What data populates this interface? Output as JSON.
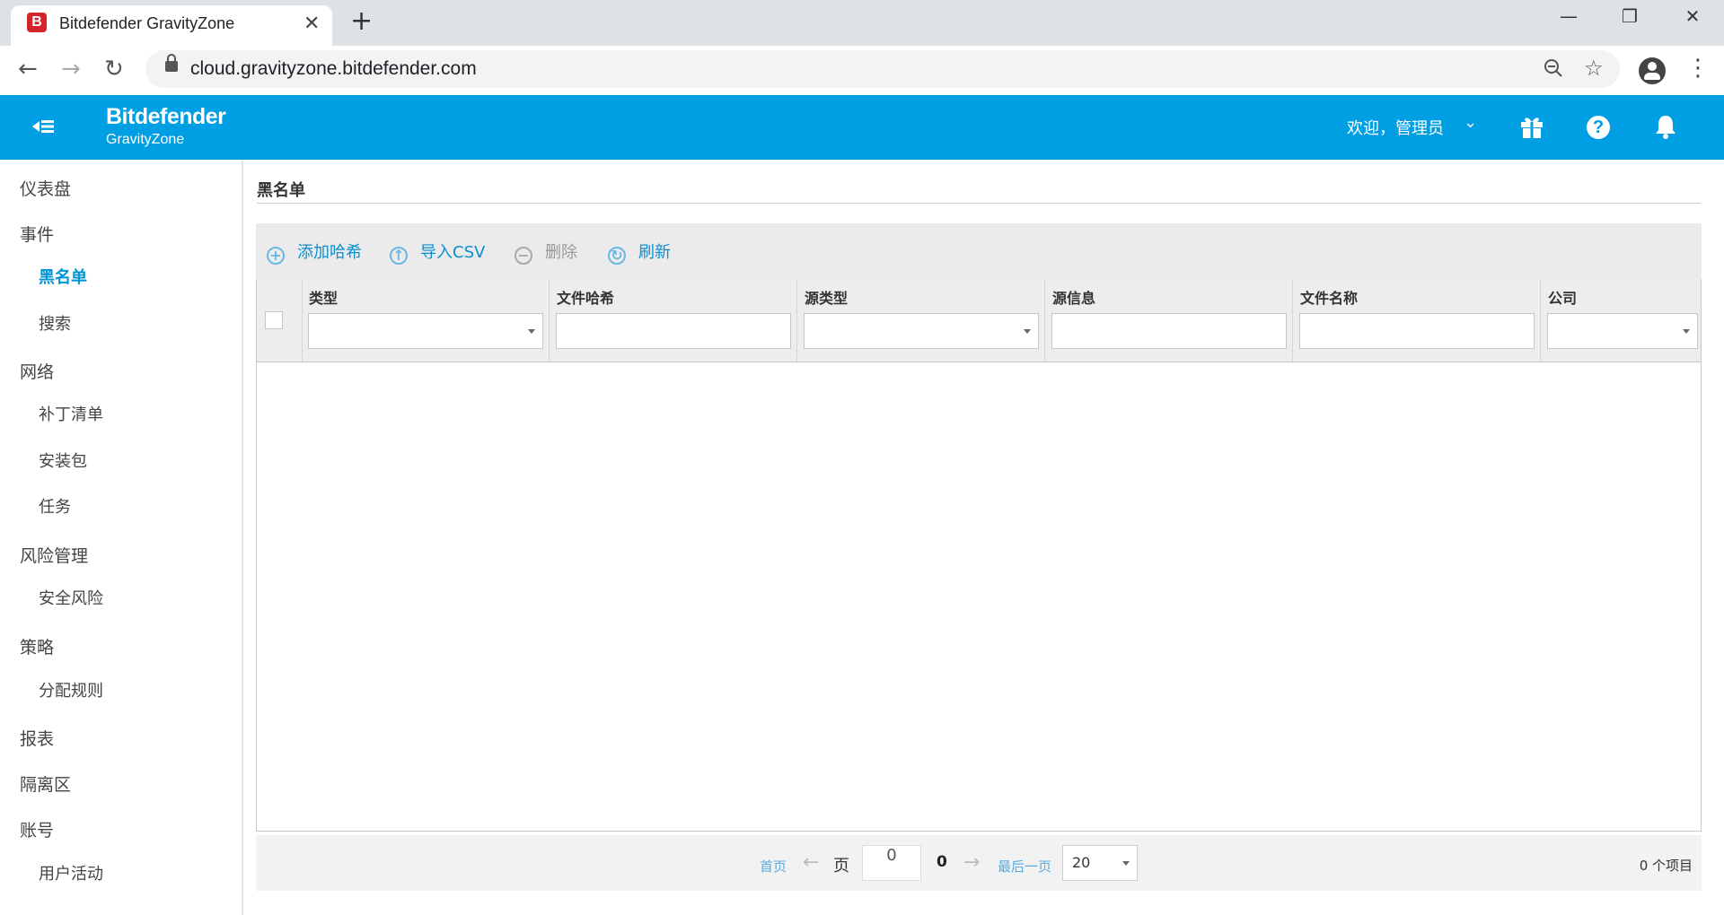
{
  "browser": {
    "tab_title": "Bitdefender GravityZone",
    "favicon_letter": "B",
    "url": "cloud.gravityzone.bitdefender.com"
  },
  "header": {
    "brand_name": "Bitdefender",
    "brand_sub": "GravityZone",
    "welcome": "欢迎，管理员",
    "accent_color": "#009ee2"
  },
  "sidebar": {
    "items": [
      {
        "label": "仪表盘"
      },
      {
        "label": "事件"
      },
      {
        "label": "黑名单"
      },
      {
        "label": "搜索"
      },
      {
        "label": "网络"
      },
      {
        "label": "补丁清单"
      },
      {
        "label": "安装包"
      },
      {
        "label": "任务"
      },
      {
        "label": "风险管理"
      },
      {
        "label": "安全风险"
      },
      {
        "label": "策略"
      },
      {
        "label": "分配规则"
      },
      {
        "label": "报表"
      },
      {
        "label": "隔离区"
      },
      {
        "label": "账号"
      },
      {
        "label": "用户活动"
      }
    ]
  },
  "main": {
    "title": "黑名单",
    "actions": {
      "add_hash": "添加哈希",
      "import_csv": "导入CSV",
      "delete": "删除",
      "refresh": "刷新"
    },
    "columns": [
      "类型",
      "文件哈希",
      "源类型",
      "源信息",
      "文件名称",
      "公司"
    ]
  },
  "pager": {
    "first": "首页",
    "page_label": "页",
    "page_value": "0",
    "total_pages": "0",
    "last": "最后一页",
    "page_size": "20",
    "item_count": "0 个项目"
  }
}
